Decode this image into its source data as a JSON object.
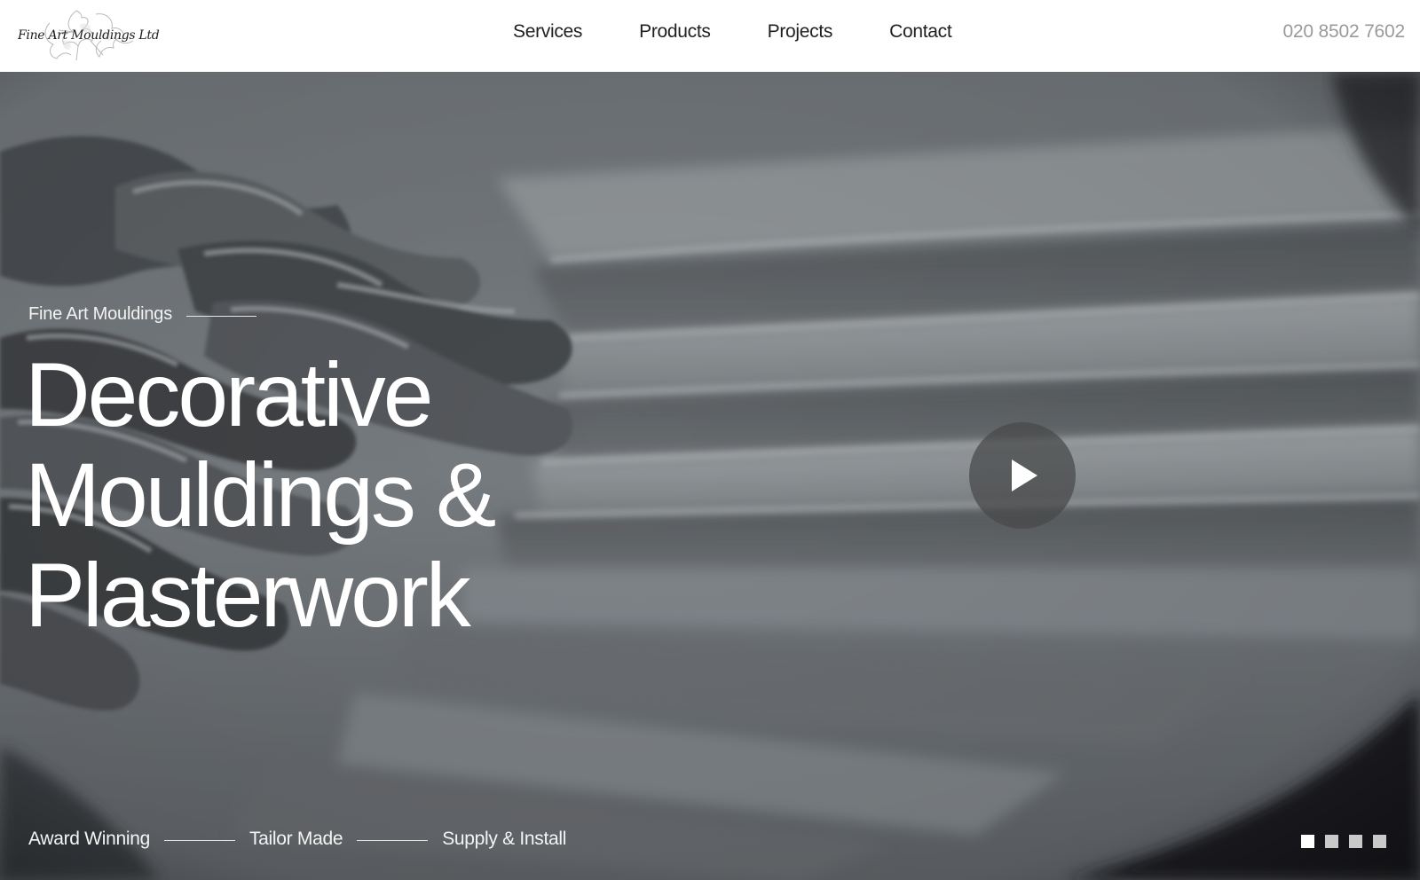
{
  "logo": {
    "text": "Fine Art Mouldings Ltd"
  },
  "nav": {
    "items": [
      "Services",
      "Products",
      "Projects",
      "Contact"
    ]
  },
  "header": {
    "phone": "020 8502 7602"
  },
  "hero": {
    "eyebrow": "Fine Art Mouldings",
    "headline": [
      "Decorative",
      "Mouldings &",
      "Plasterwork"
    ],
    "play_icon": "play-icon",
    "features": [
      "Award Winning",
      "Tailor Made",
      "Supply & Install"
    ],
    "slider": {
      "total": 4,
      "active": 1
    }
  },
  "colors": {
    "header_bg": "#ffffff",
    "nav_text": "#1f1f1f",
    "phone_text": "#9a9a9a",
    "hero_text": "#ffffff"
  }
}
